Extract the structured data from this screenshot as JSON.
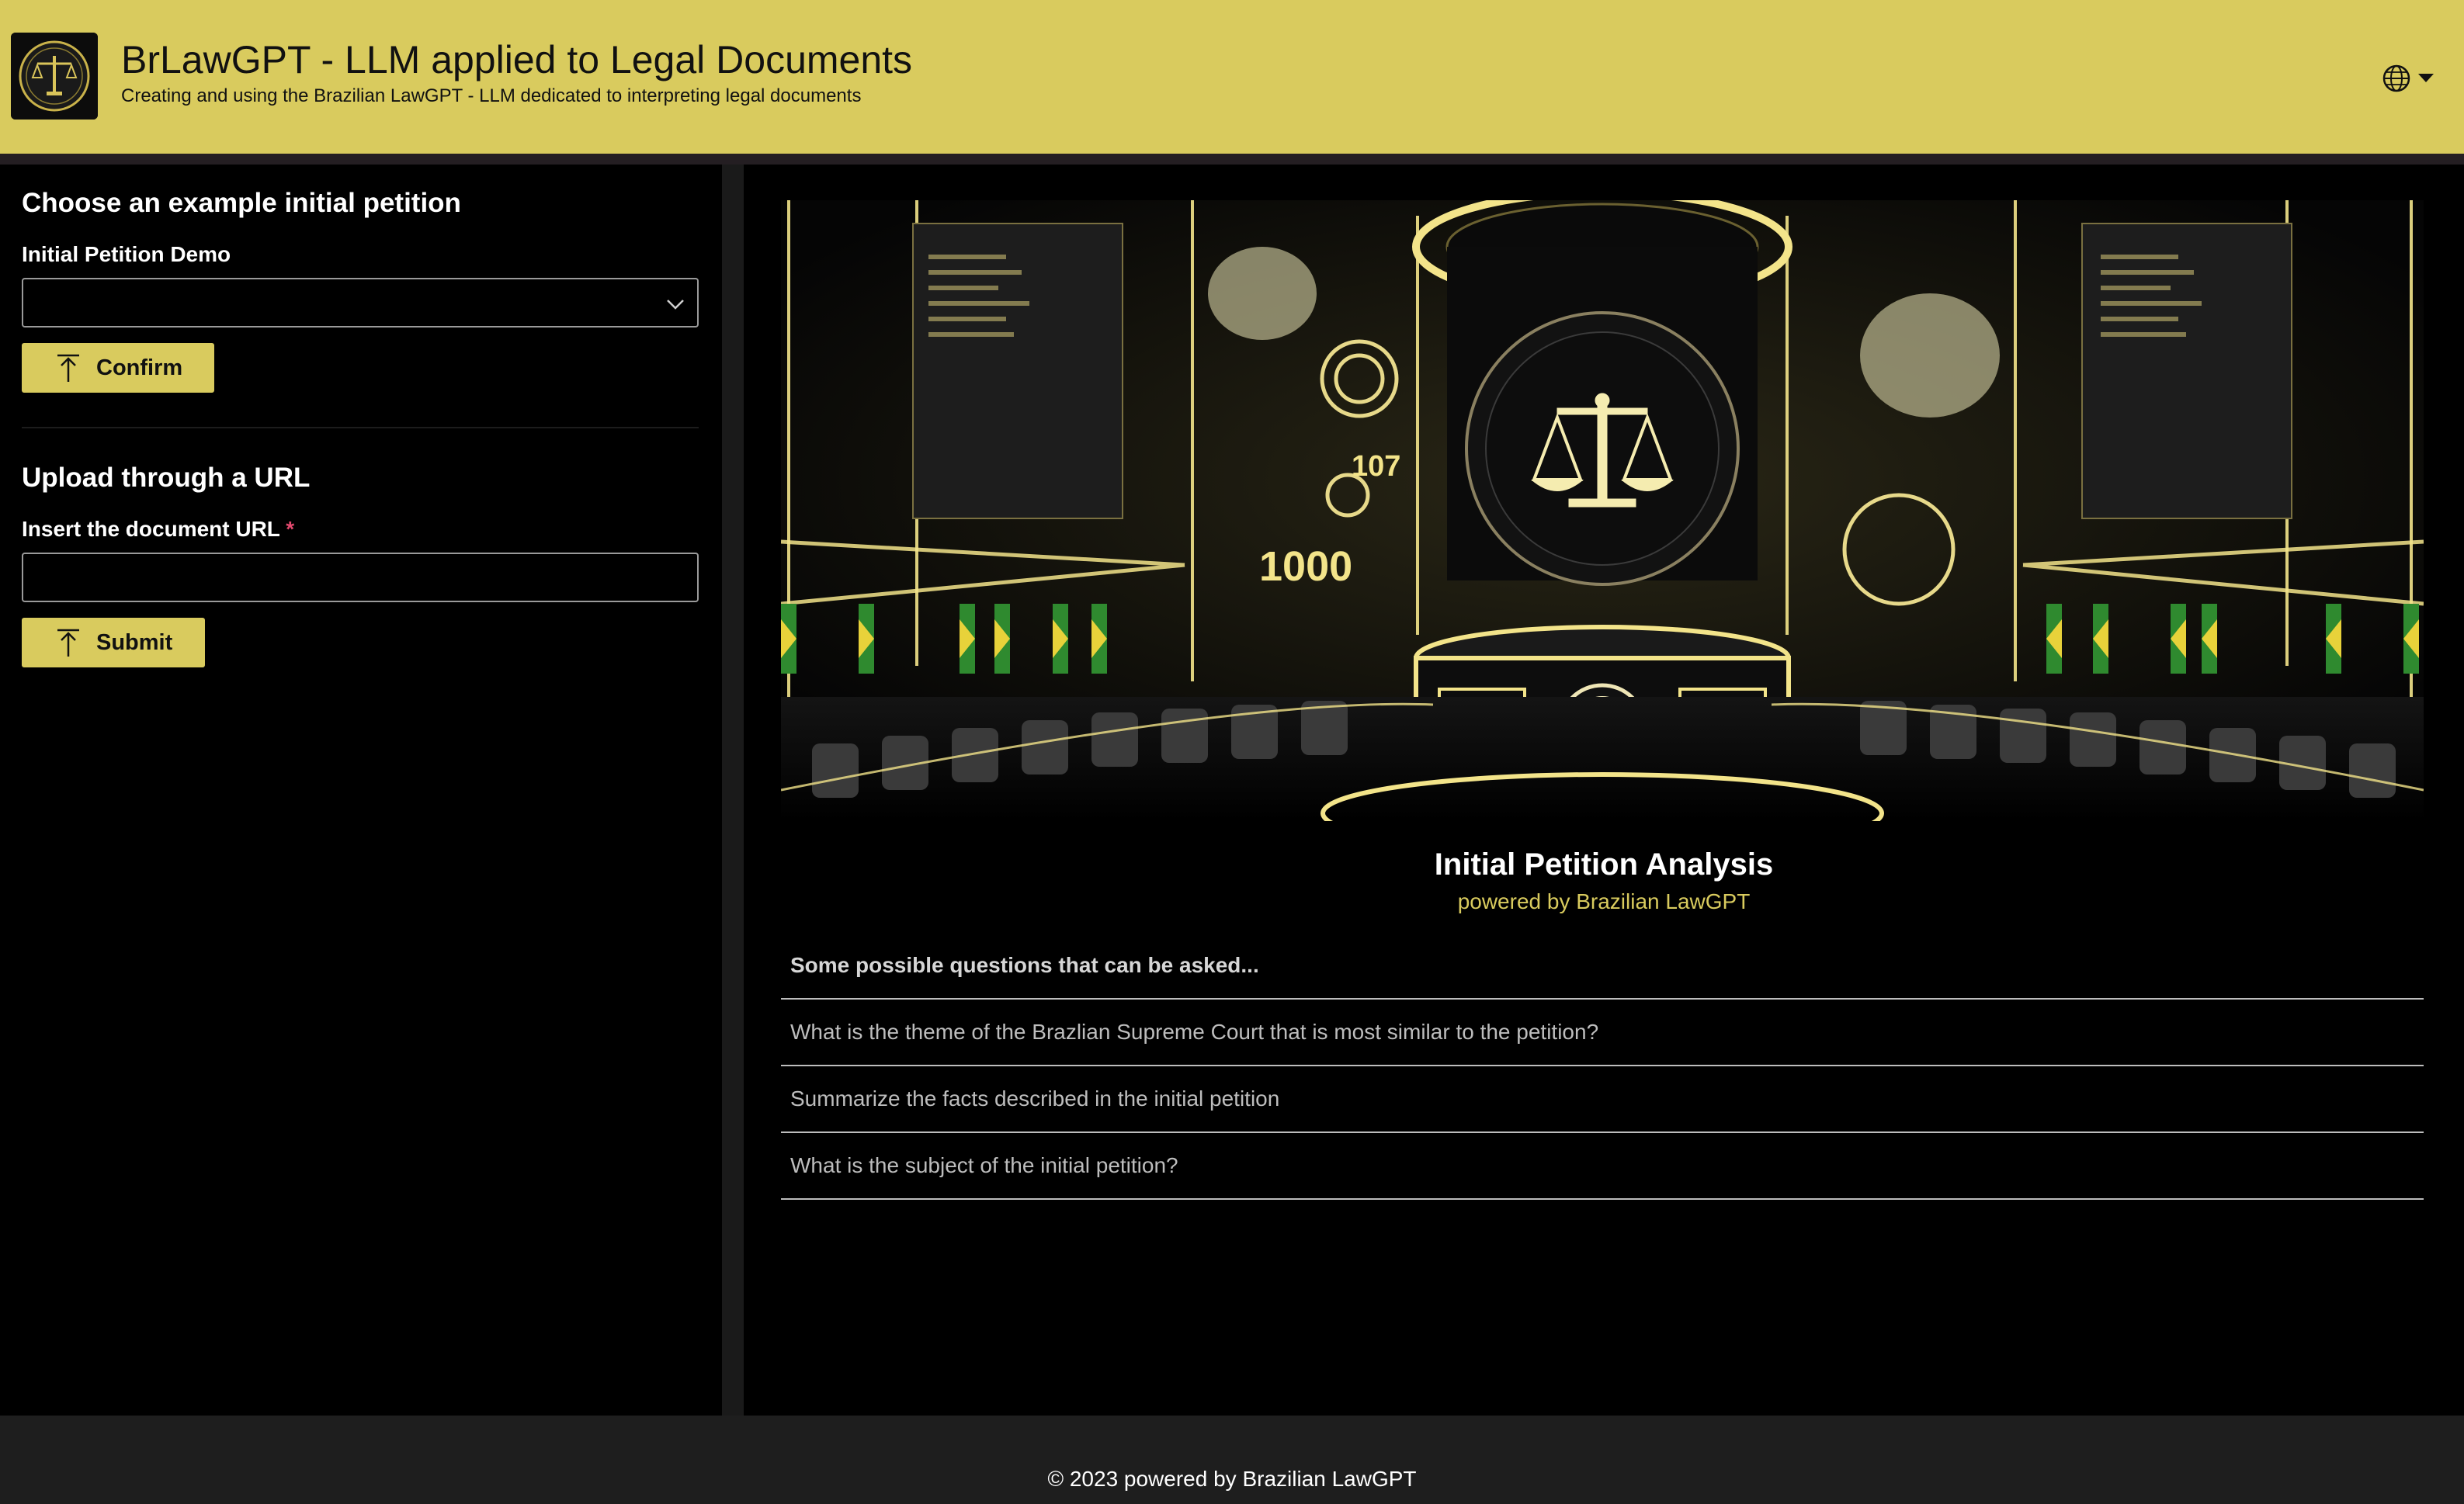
{
  "header": {
    "title": "BrLawGPT - LLM applied to Legal Documents",
    "subtitle": "Creating and using the Brazilian LawGPT - LLM dedicated to interpreting legal documents"
  },
  "left": {
    "example_section": {
      "heading": "Choose an example initial petition",
      "select_label": "Initial Petition Demo",
      "select_value": "",
      "button_label": "Confirm"
    },
    "url_section": {
      "heading": "Upload through a URL",
      "input_label": "Insert the document URL",
      "required_mark": "*",
      "input_value": "",
      "button_label": "Submit"
    }
  },
  "main": {
    "banner_banner_number_a": "107",
    "banner_banner_number_b": "1000",
    "title": "Initial Petition Analysis",
    "subtitle": "powered by Brazilian LawGPT",
    "questions_header": "Some possible questions that can be asked...",
    "questions": [
      "What is the theme of the Brazlian Supreme Court that is most similar to the petition?",
      "Summarize the facts described in the initial petition",
      "What is the subject of the initial petition?"
    ]
  },
  "footer": {
    "text": "© 2023 powered by Brazilian LawGPT"
  },
  "colors": {
    "accent": "#d9cb5e",
    "background": "#000000",
    "footer": "#1e1e1e"
  }
}
